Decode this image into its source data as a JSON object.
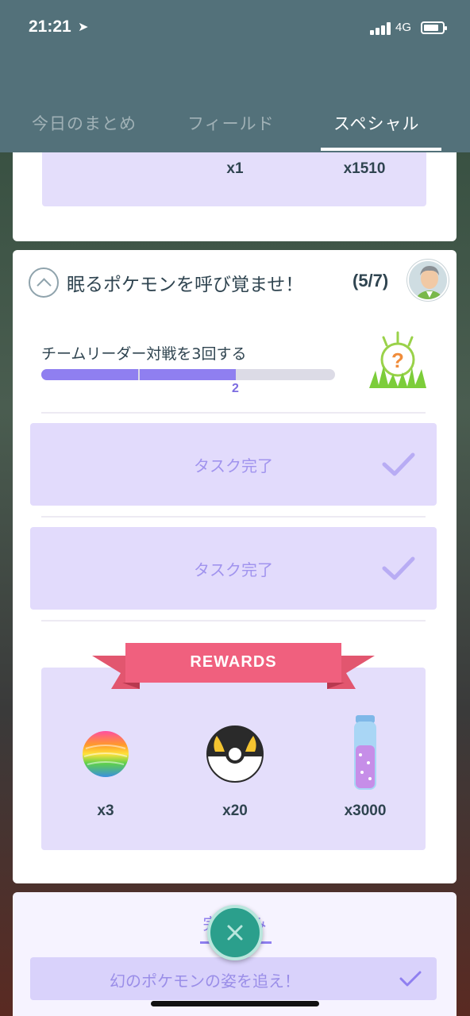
{
  "status_bar": {
    "time": "21:21",
    "network": "4G"
  },
  "tabs": [
    {
      "label": "今日のまとめ",
      "active": false
    },
    {
      "label": "フィールド",
      "active": false
    },
    {
      "label": "スペシャル",
      "active": true
    }
  ],
  "prev_card": {
    "rewards": [
      {
        "qty": "x1"
      },
      {
        "qty": "x1510"
      }
    ]
  },
  "quest": {
    "title": "眠るポケモンを呼び覚ませ！",
    "count": "(5/7)",
    "task": {
      "text": "チームリーダー対戦を3回する",
      "progress_value": 2,
      "progress_max": 3,
      "progress_label": "2",
      "reward_icon": "mystery-encounter-icon"
    },
    "completed_tasks": [
      {
        "label": "タスク完了"
      },
      {
        "label": "タスク完了"
      }
    ],
    "rewards_title": "REWARDS",
    "rewards": [
      {
        "icon": "rare-candy-icon",
        "qty": "x3"
      },
      {
        "icon": "ultra-ball-icon",
        "qty": "x20"
      },
      {
        "icon": "stardust-icon",
        "qty": "x3000"
      }
    ]
  },
  "completed_section": {
    "title": "完了済み",
    "items": [
      {
        "label": "幻のポケモンの姿を追え！"
      }
    ]
  },
  "colors": {
    "header": "#53717a",
    "accent": "#8f7ff0",
    "ribbon": "#f0607e",
    "close": "#2b9f8c"
  }
}
